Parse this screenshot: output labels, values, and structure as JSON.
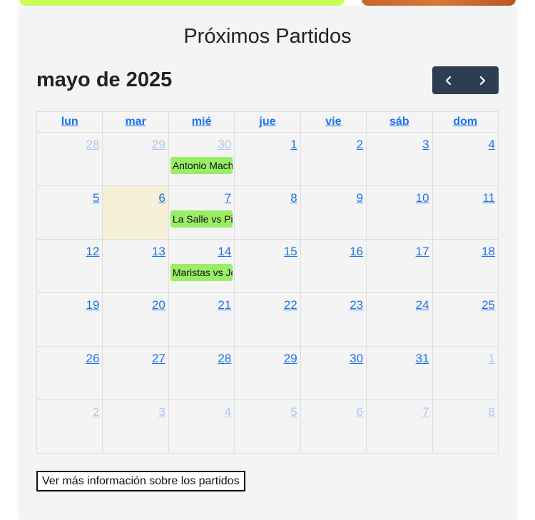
{
  "section": {
    "title": "Próximos Partidos"
  },
  "calendar": {
    "month_label": "mayo de 2025",
    "weekdays": [
      "lun",
      "mar",
      "mié",
      "jue",
      "vie",
      "sáb",
      "dom"
    ],
    "weeks": [
      [
        {
          "day": "28",
          "other": true
        },
        {
          "day": "29",
          "other": true
        },
        {
          "day": "30",
          "other": true,
          "event": "Antonio Machado vs"
        },
        {
          "day": "1"
        },
        {
          "day": "2"
        },
        {
          "day": "3"
        },
        {
          "day": "4"
        }
      ],
      [
        {
          "day": "5"
        },
        {
          "day": "6",
          "today": true
        },
        {
          "day": "7",
          "event": "La Salle vs Pinar"
        },
        {
          "day": "8"
        },
        {
          "day": "9"
        },
        {
          "day": "10"
        },
        {
          "day": "11"
        }
      ],
      [
        {
          "day": "12"
        },
        {
          "day": "13"
        },
        {
          "day": "14",
          "event": "Maristas vs Jesuitas"
        },
        {
          "day": "15"
        },
        {
          "day": "16"
        },
        {
          "day": "17"
        },
        {
          "day": "18"
        }
      ],
      [
        {
          "day": "19"
        },
        {
          "day": "20"
        },
        {
          "day": "21"
        },
        {
          "day": "22"
        },
        {
          "day": "23"
        },
        {
          "day": "24"
        },
        {
          "day": "25"
        }
      ],
      [
        {
          "day": "26"
        },
        {
          "day": "27"
        },
        {
          "day": "28"
        },
        {
          "day": "29"
        },
        {
          "day": "30"
        },
        {
          "day": "31"
        },
        {
          "day": "1",
          "other": true
        }
      ],
      [
        {
          "day": "2",
          "other": true
        },
        {
          "day": "3",
          "other": true
        },
        {
          "day": "4",
          "other": true
        },
        {
          "day": "5",
          "other": true
        },
        {
          "day": "6",
          "other": true
        },
        {
          "day": "7",
          "other": true
        },
        {
          "day": "8",
          "other": true
        }
      ]
    ]
  },
  "footer": {
    "more_info_label": "Ver más información sobre los partidos"
  },
  "colors": {
    "event_bg": "#99ee66",
    "today_bg": "#f5f0d8",
    "nav_bg": "#2c3e50",
    "link": "#1a73e8",
    "top_accent": "#ccff55"
  },
  "icons": {
    "prev": "chevron-left-icon",
    "next": "chevron-right-icon"
  }
}
